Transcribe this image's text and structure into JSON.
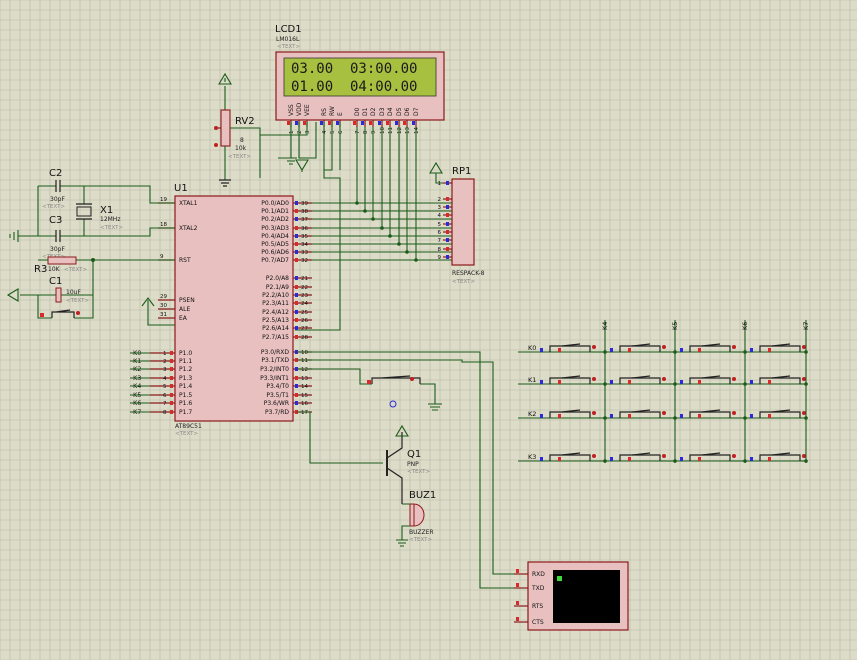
{
  "components": {
    "lcd": {
      "ref": "LCD1",
      "model": "LM016L",
      "placeholder": "<TEXT>",
      "line1": "03.00  03:00.00",
      "line2": "01.00  04:00.00",
      "pins": [
        "VSS",
        "VDD",
        "VEE",
        "RS",
        "RW",
        "E",
        "D0",
        "D1",
        "D2",
        "D3",
        "D4",
        "D5",
        "D6",
        "D7"
      ],
      "pin_numbers": [
        "1",
        "2",
        "3",
        "4",
        "5",
        "6",
        "7",
        "8",
        "9",
        "10",
        "11",
        "12",
        "13",
        "14"
      ]
    },
    "rv2": {
      "ref": "RV2",
      "value": "10k",
      "pin": "8",
      "placeholder": "<TEXT>"
    },
    "c2": {
      "ref": "C2",
      "value": "30pF",
      "placeholder": "<TEXT>"
    },
    "c3": {
      "ref": "C3",
      "value": "30pF",
      "placeholder": "<TEXT>"
    },
    "x1": {
      "ref": "X1",
      "value": "12MHz",
      "placeholder": "<TEXT>"
    },
    "r3": {
      "ref": "R3",
      "value": "10K",
      "placeholder": "<TEXT>"
    },
    "c1": {
      "ref": "C1",
      "value": "10uF",
      "placeholder": "<TEXT>"
    },
    "u1": {
      "ref": "U1",
      "model": "AT89C51",
      "placeholder": "<TEXT>",
      "left_pins": [
        {
          "num": "19",
          "name": "XTAL1"
        },
        {
          "num": "18",
          "name": "XTAL2"
        },
        {
          "num": "9",
          "name": "RST"
        },
        {
          "num": "29",
          "name": "PSEN"
        },
        {
          "num": "30",
          "name": "ALE"
        },
        {
          "num": "31",
          "name": "EA"
        }
      ],
      "p1_pins": [
        {
          "num": "1",
          "name": "P1.0",
          "net": "K0"
        },
        {
          "num": "2",
          "name": "P1.1",
          "net": "K1"
        },
        {
          "num": "3",
          "name": "P1.2",
          "net": "K2"
        },
        {
          "num": "4",
          "name": "P1.3",
          "net": "K3"
        },
        {
          "num": "5",
          "name": "P1.4",
          "net": "K4"
        },
        {
          "num": "6",
          "name": "P1.5",
          "net": "K5"
        },
        {
          "num": "7",
          "name": "P1.6",
          "net": "K6"
        },
        {
          "num": "8",
          "name": "P1.7",
          "net": "K7"
        }
      ],
      "p0_pins": [
        {
          "num": "39",
          "name": "P0.0/AD0"
        },
        {
          "num": "38",
          "name": "P0.1/AD1"
        },
        {
          "num": "37",
          "name": "P0.2/AD2"
        },
        {
          "num": "36",
          "name": "P0.3/AD3"
        },
        {
          "num": "35",
          "name": "P0.4/AD4"
        },
        {
          "num": "34",
          "name": "P0.5/AD5"
        },
        {
          "num": "33",
          "name": "P0.6/AD6"
        },
        {
          "num": "32",
          "name": "P0.7/AD7"
        }
      ],
      "p2_pins": [
        {
          "num": "21",
          "name": "P2.0/A8"
        },
        {
          "num": "22",
          "name": "P2.1/A9"
        },
        {
          "num": "23",
          "name": "P2.2/A10"
        },
        {
          "num": "24",
          "name": "P2.3/A11"
        },
        {
          "num": "25",
          "name": "P2.4/A12"
        },
        {
          "num": "26",
          "name": "P2.5/A13"
        },
        {
          "num": "27",
          "name": "P2.6/A14"
        },
        {
          "num": "28",
          "name": "P2.7/A15"
        }
      ],
      "p3_pins": [
        {
          "num": "10",
          "name": "P3.0/RXD"
        },
        {
          "num": "11",
          "name": "P3.1/TXD"
        },
        {
          "num": "12",
          "name": "P3.2/INT0"
        },
        {
          "num": "13",
          "name": "P3.3/INT1"
        },
        {
          "num": "14",
          "name": "P3.4/T0"
        },
        {
          "num": "15",
          "name": "P3.5/T1"
        },
        {
          "num": "16",
          "name": "P3.6/WR"
        },
        {
          "num": "17",
          "name": "P3.7/RD"
        }
      ]
    },
    "rp1": {
      "ref": "RP1",
      "model": "RESPACK-8",
      "placeholder": "<TEXT>",
      "pins": [
        "1",
        "2",
        "3",
        "4",
        "5",
        "6",
        "7",
        "8",
        "9"
      ]
    },
    "q1": {
      "ref": "Q1",
      "model": "PNP",
      "placeholder": "<TEXT>"
    },
    "buz1": {
      "ref": "BUZ1",
      "model": "BUZZER",
      "placeholder": "<TEXT>"
    },
    "terminal": {
      "pins": [
        "RXD",
        "TXD",
        "RTS",
        "CTS"
      ]
    },
    "keypad": {
      "rows": [
        "K0",
        "K1",
        "K2",
        "K3"
      ],
      "cols": [
        "K4",
        "K5",
        "K6",
        "K7"
      ]
    }
  },
  "colors": {
    "background": "#dcdcc8",
    "wire": "#1a5c1a",
    "body": "#e8c0c0",
    "lcd": "#a8c040"
  }
}
